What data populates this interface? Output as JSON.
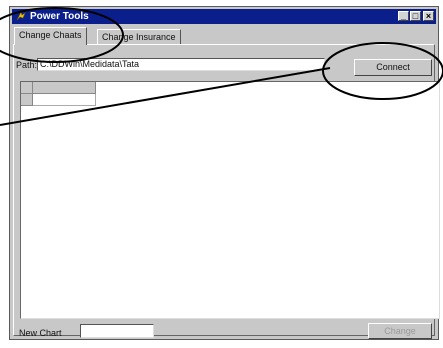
{
  "window": {
    "title": "Power Tools",
    "minimize_glyph": "_",
    "maximize_glyph": "□",
    "close_glyph": "×",
    "title_bar_color": "#0a1f8c"
  },
  "tabs": [
    {
      "label": "Change Chaats",
      "active": true
    },
    {
      "label": "Change Insurance",
      "active": false
    }
  ],
  "path": {
    "label": "Path:",
    "value": "C:\\DDWin\\Medidata\\Tata"
  },
  "connect_button": {
    "label": "Connect"
  },
  "new_chart": {
    "label": "New Chart",
    "value": ""
  },
  "change_button": {
    "label": "Change"
  },
  "annotation": {
    "color": "#000000"
  },
  "icons": {
    "app": "power-tools-icon"
  }
}
